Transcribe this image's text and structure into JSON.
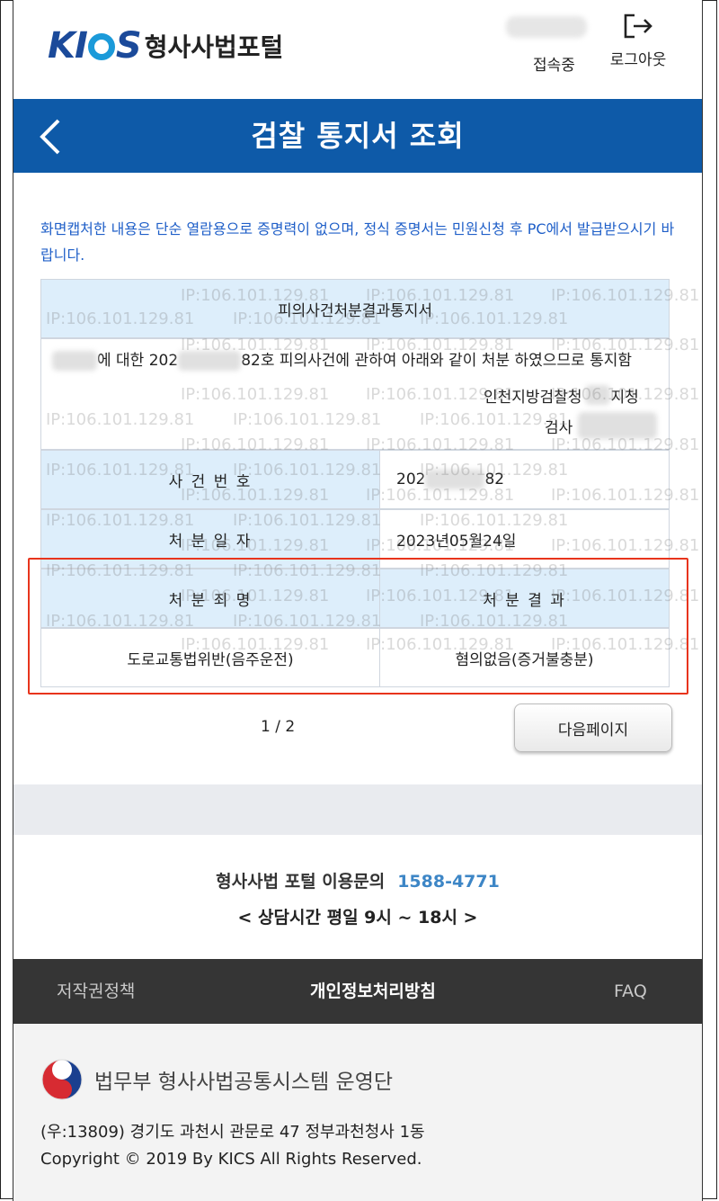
{
  "header": {
    "logo_text": "KICS",
    "portal_name": "형사사법포털",
    "connection_status": "접속중",
    "logout_label": "로그아웃"
  },
  "titlebar": {
    "title": "검찰 통지서 조회"
  },
  "notice": "화면캡처한 내용은 단순 열람용으로 증명력이 없으며, 정식 증명서는 민원신청 후 PC에서 발급받으시기 바랍니다.",
  "document": {
    "heading": "피의사건처분결과통지서",
    "body_parts": [
      "에 대한 202",
      "82호 피의사건에 관하여 아래와 같이 처분 하였으므로 통지함"
    ],
    "office": "인천지방검찰청",
    "branch_suffix": "지청",
    "prosecutor_label": "검사",
    "case_no_label": "사 건 번 호",
    "case_no_prefix": "202",
    "case_no_suffix": "82",
    "date_label": "처 분 일 자",
    "date_value": "2023년05월24일",
    "charge_label": "처 분 죄 명",
    "result_label": "처 분 결 과",
    "charge_value": "도로교통법위반(음주운전)",
    "result_value": "혐의없음(증거불충분)",
    "watermark": "IP:106.101.129.81"
  },
  "pager": {
    "page_indicator": "1 / 2",
    "next_label": "다음페이지"
  },
  "contact": {
    "label": "형사사법 포털 이용문의",
    "phone": "1588-4771",
    "hours": "< 상담시간 평일 9시 ~ 18시 >"
  },
  "footer_nav": {
    "copyright_policy": "저작권정책",
    "privacy_policy": "개인정보처리방침",
    "faq": "FAQ"
  },
  "footer": {
    "org_name": "법무부 형사사법공통시스템 운영단",
    "address": "(우:13809) 경기도 과천시 관문로 47 정부과천청사 1동",
    "copyright": "Copyright © 2019 By KICS All Rights Reserved."
  },
  "colors": {
    "brand_blue": "#0e5aa8",
    "notice_blue": "#1f5fc8",
    "phone_blue": "#3d86c6",
    "highlight_red": "#e8341c",
    "table_header_bg": "#ddeefb"
  }
}
